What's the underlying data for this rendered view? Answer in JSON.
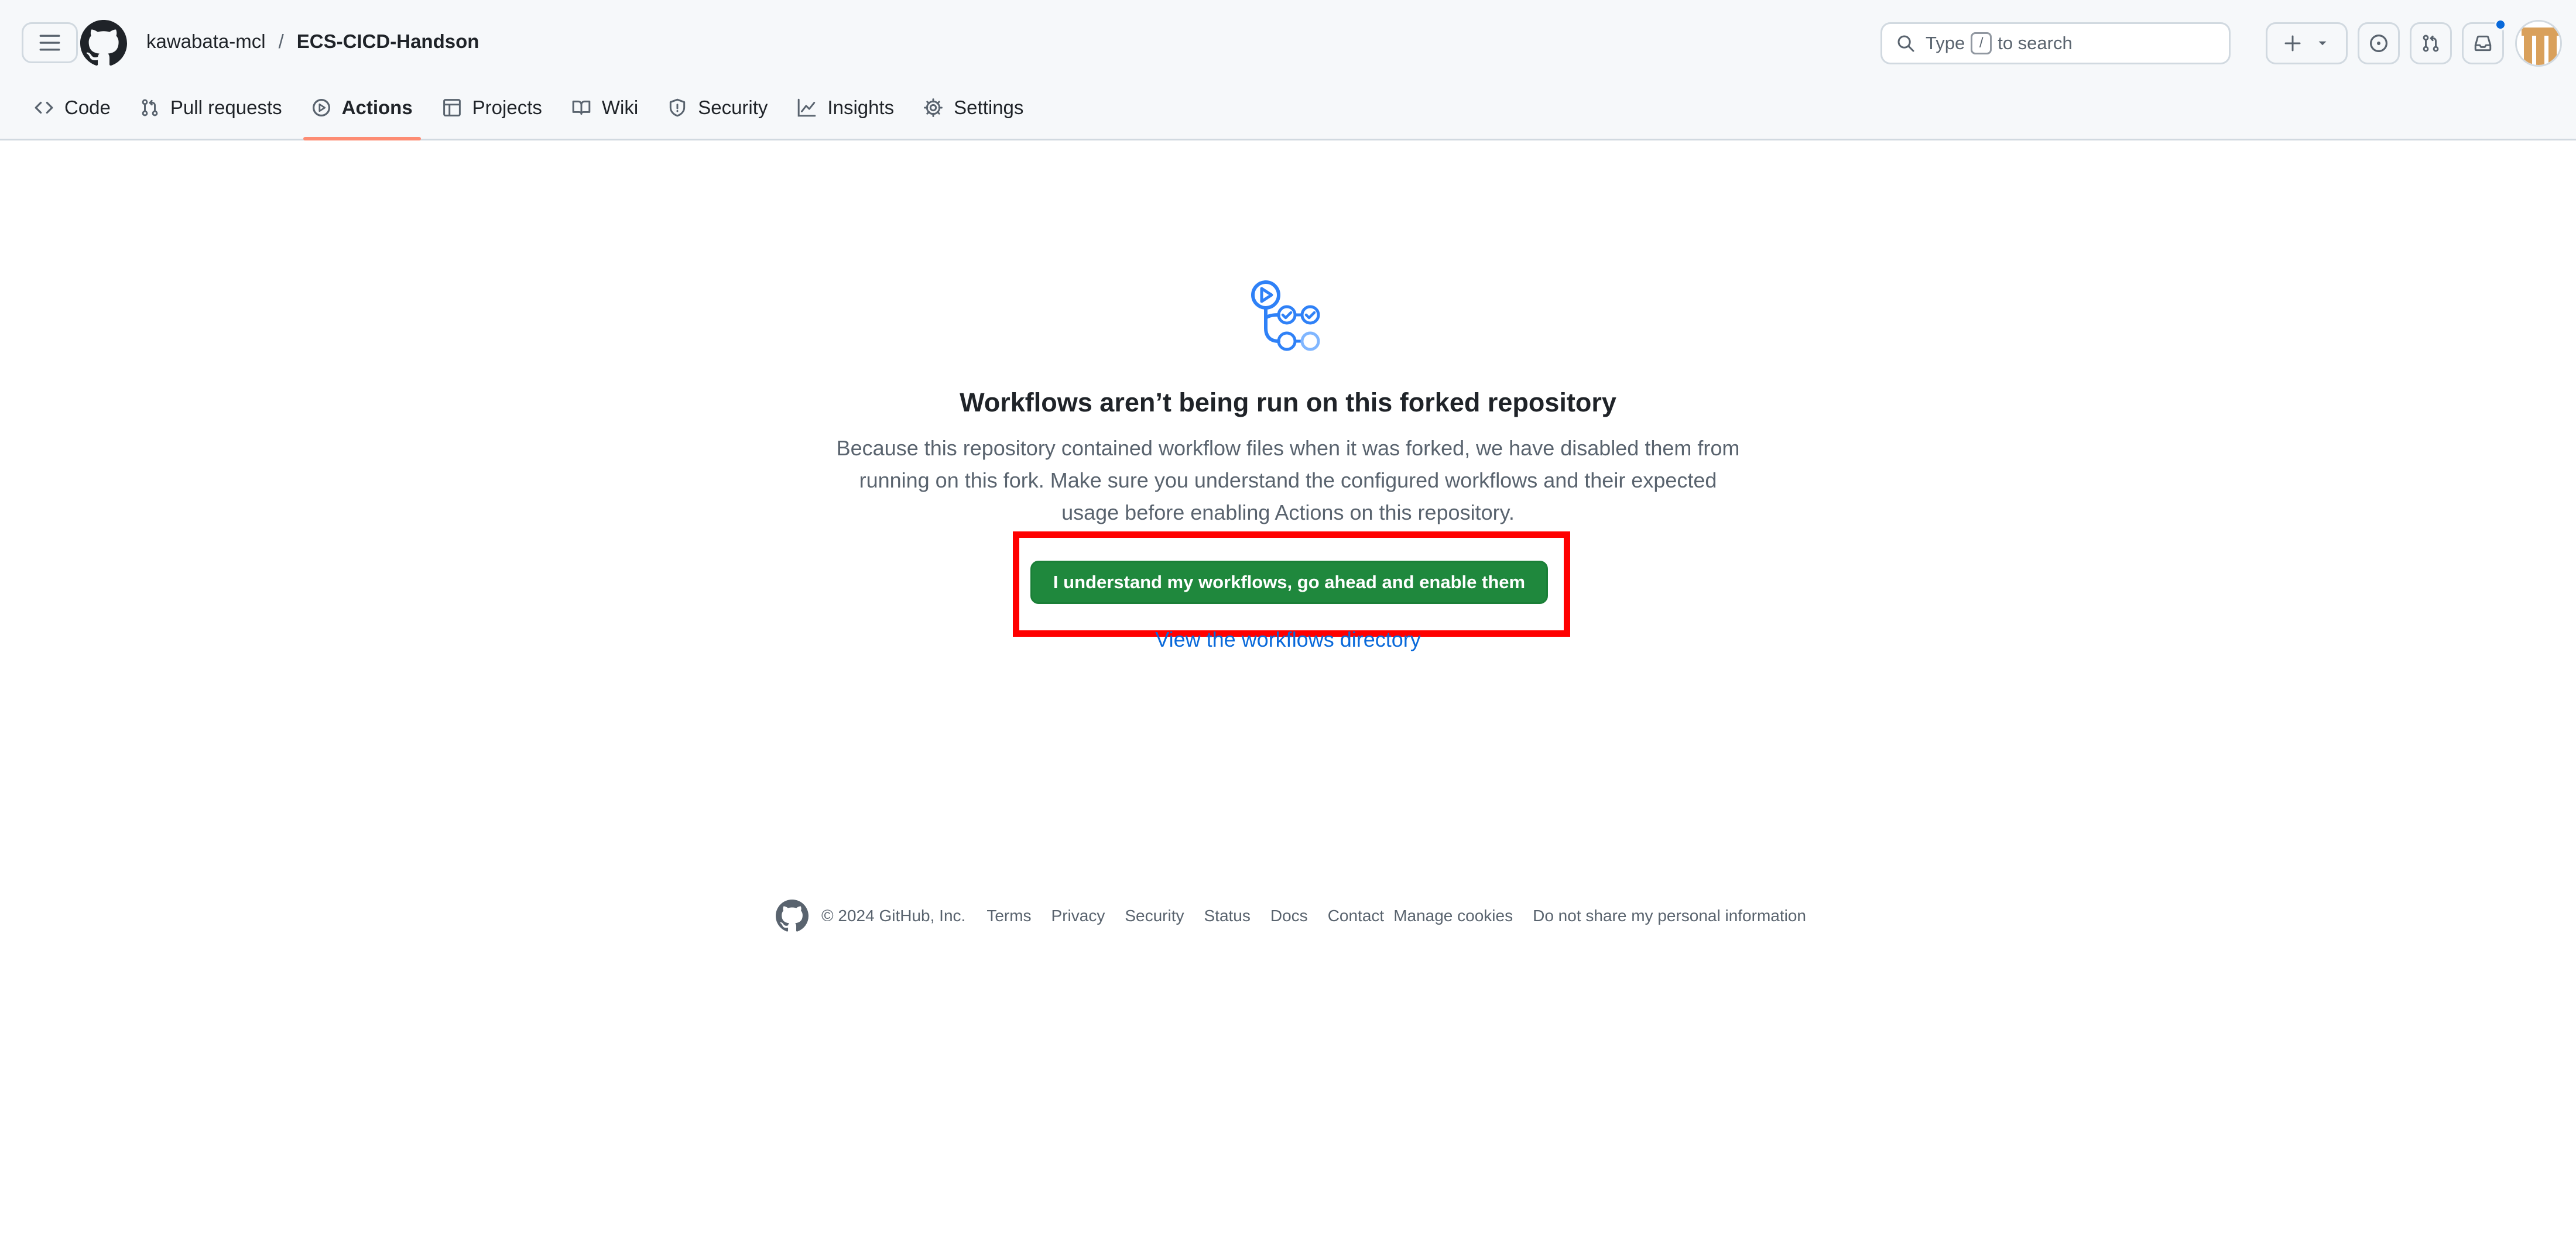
{
  "header": {
    "owner": "kawabata-mcl",
    "separator": "/",
    "repo": "ECS-CICD-Handson",
    "search": {
      "prefix": "Type",
      "key": "/",
      "suffix": "to search"
    },
    "notification_dot_color": "#0969da"
  },
  "tabs": [
    {
      "label": "Code",
      "icon": "code-icon",
      "active": false
    },
    {
      "label": "Pull requests",
      "icon": "git-pull-request-icon",
      "active": false
    },
    {
      "label": "Actions",
      "icon": "play-icon",
      "active": true
    },
    {
      "label": "Projects",
      "icon": "table-icon",
      "active": false
    },
    {
      "label": "Wiki",
      "icon": "book-icon",
      "active": false
    },
    {
      "label": "Security",
      "icon": "shield-icon",
      "active": false
    },
    {
      "label": "Insights",
      "icon": "graph-icon",
      "active": false
    },
    {
      "label": "Settings",
      "icon": "gear-icon",
      "active": false
    }
  ],
  "main": {
    "icon": "workflow-icon",
    "title": "Workflows aren’t being run on this forked repository",
    "description_lines": [
      "Because this repository contained workflow files when it was forked, we have disabled them from",
      "running on this fork. Make sure you understand the configured workflows and their expected",
      "usage before enabling Actions on this repository."
    ],
    "enable_button": "I understand my workflows, go ahead and enable them",
    "directory_link": "View the workflows directory"
  },
  "footer": {
    "copyright": "© 2024 GitHub, Inc.",
    "links": [
      "Terms",
      "Privacy",
      "Security",
      "Status",
      "Docs",
      "Contact",
      "Manage cookies",
      "Do not share my personal information"
    ]
  },
  "colors": {
    "accent_link": "#0969da",
    "primary_button": "#1f883d",
    "active_tab_underline": "#fd8c73",
    "highlight_box": "#ff0000"
  }
}
